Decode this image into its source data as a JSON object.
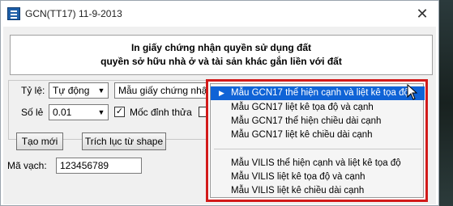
{
  "window": {
    "title": "GCN(TT17) 11-9-2013",
    "close_label": "✕"
  },
  "header": {
    "line1": "In giấy chứng nhận quyền sử dụng đất",
    "line2": "quyền sở hữu nhà ở và tài sản khác gắn liền với đất"
  },
  "form": {
    "scale_label": "Tỷ lệ:",
    "scale_value": "Tự động",
    "decimals_label": "Số lẻ",
    "decimals_value": "0.01",
    "template_value": "Mẫu giấy chứng nhận",
    "plot_marker_label": "Mốc đỉnh thửa",
    "plot_marker_checked": true,
    "extra_checkbox_checked": false
  },
  "buttons": {
    "create_new": "Tạo mới",
    "extract_shape": "Trích lục từ shape"
  },
  "barcode": {
    "label": "Mã vạch:",
    "value": "123456789"
  },
  "dropdown": {
    "items": [
      {
        "label": "Mẫu GCN17 thể hiện cạnh và liệt kê tọa độ",
        "selected": true
      },
      {
        "label": "Mẫu GCN17 liệt kê tọa độ và cạnh",
        "selected": false
      },
      {
        "label": "Mẫu GCN17 thể hiện chiều dài cạnh",
        "selected": false
      },
      {
        "label": "Mẫu GCN17 liệt kê chiều dài cạnh",
        "selected": false
      },
      {
        "label": "Mẫu VILIS thể hiện cạnh và liệt kê tọa độ",
        "selected": false
      },
      {
        "label": "Mẫu VILIS liệt kê tọa độ và cạnh",
        "selected": false
      },
      {
        "label": "Mẫu VILIS liệt kê chiều dài cạnh",
        "selected": false
      }
    ],
    "highlight_color": "#0f63d6",
    "annotation_border_color": "#d21a1a"
  }
}
